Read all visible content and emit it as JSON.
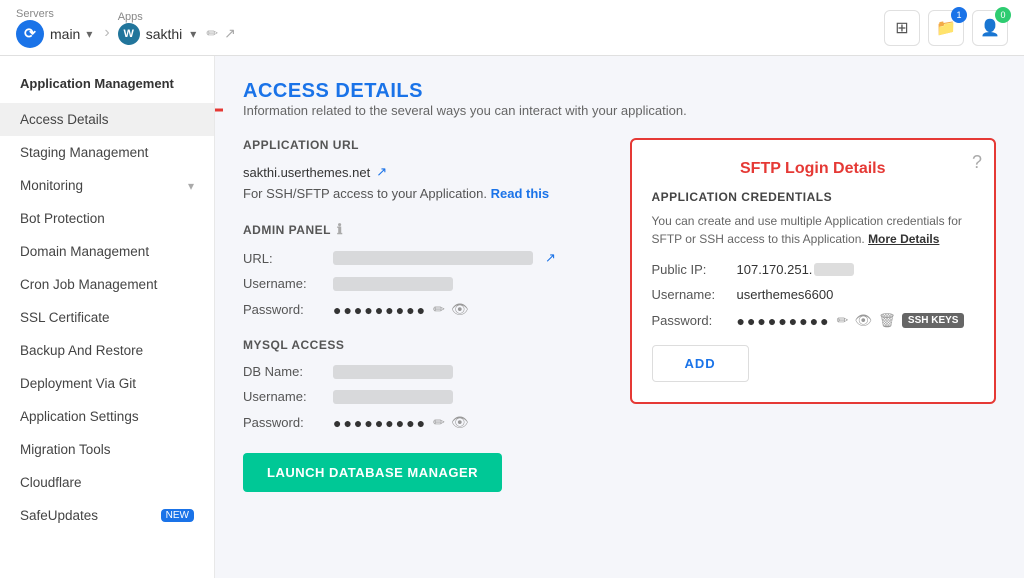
{
  "topnav": {
    "servers_label": "Servers",
    "apps_label": "Apps",
    "server_name": "main",
    "app_name": "sakthi",
    "files_badge": "1",
    "users_badge": "0"
  },
  "sidebar": {
    "title": "Application Management",
    "items": [
      {
        "id": "access-details",
        "label": "Access Details",
        "active": true
      },
      {
        "id": "staging-management",
        "label": "Staging Management",
        "active": false
      },
      {
        "id": "monitoring",
        "label": "Monitoring",
        "active": false,
        "has_chevron": true
      },
      {
        "id": "bot-protection",
        "label": "Bot Protection",
        "active": false
      },
      {
        "id": "domain-management",
        "label": "Domain Management",
        "active": false
      },
      {
        "id": "cron-job-management",
        "label": "Cron Job Management",
        "active": false
      },
      {
        "id": "ssl-certificate",
        "label": "SSL Certificate",
        "active": false
      },
      {
        "id": "backup-and-restore",
        "label": "Backup And Restore",
        "active": false
      },
      {
        "id": "deployment-via-git",
        "label": "Deployment Via Git",
        "active": false
      },
      {
        "id": "application-settings",
        "label": "Application Settings",
        "active": false
      },
      {
        "id": "migration-tools",
        "label": "Migration Tools",
        "active": false
      },
      {
        "id": "cloudflare",
        "label": "Cloudflare",
        "active": false
      },
      {
        "id": "safeupdates",
        "label": "SafeUpdates",
        "active": false,
        "badge": "NEW"
      }
    ]
  },
  "page": {
    "title": "ACCESS DETAILS",
    "description": "Information related to the several ways you can interact with your application."
  },
  "access_details": {
    "app_url_section": {
      "title": "APPLICATION URL",
      "url": "sakthi.userthemes.net",
      "ssh_sftp_text": "For SSH/SFTP access to your Application.",
      "read_this_label": "Read this"
    },
    "admin_panel_section": {
      "title": "ADMIN PANEL",
      "url_label": "URL:",
      "username_label": "Username:",
      "password_label": "Password:",
      "password_dots": "●●●●●●●●●"
    },
    "mysql_section": {
      "title": "MYSQL ACCESS",
      "db_name_label": "DB Name:",
      "username_label": "Username:",
      "password_label": "Password:",
      "password_dots": "●●●●●●●●●",
      "launch_db_label": "LAUNCH DATABASE MANAGER"
    }
  },
  "sftp_panel": {
    "badge_title": "SFTP Login Details",
    "credentials_title": "APPLICATION CREDENTIALS",
    "credentials_desc": "You can create and use multiple Application credentials for SFTP or SSH access to this Application.",
    "more_details_label": "More Details",
    "public_ip_label": "Public IP:",
    "public_ip_value": "107.170.251.",
    "username_label": "Username:",
    "username_value": "userthemes6600",
    "password_label": "Password:",
    "password_dots": "●●●●●●●●●",
    "ssh_keys_label": "SSH KEYS",
    "add_label": "ADD"
  }
}
